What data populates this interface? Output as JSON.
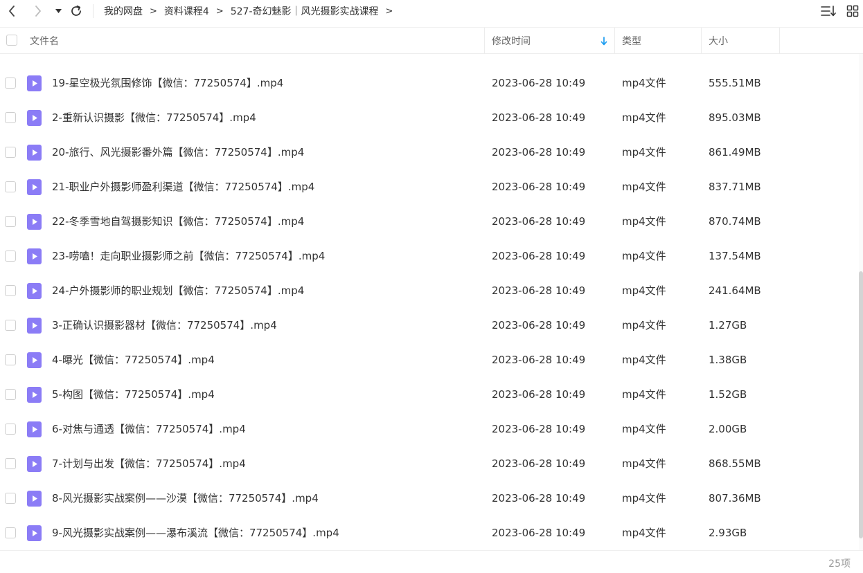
{
  "nav": {
    "breadcrumb": [
      {
        "label": "我的网盘"
      },
      {
        "label": "资料课程4"
      },
      {
        "label": "527-奇幻魅影｜风光摄影实战课程"
      }
    ],
    "separator": ">"
  },
  "columns": {
    "name": "文件名",
    "modified": "修改时间",
    "type": "类型",
    "size": "大小"
  },
  "sort": {
    "column": "modified",
    "direction": "descending",
    "arrow_color": "#1a9cf0"
  },
  "colors": {
    "file_icon": "#8b7cf6",
    "text": "#333333",
    "muted": "#999999"
  },
  "files": [
    {
      "name": "19-星空极光氛围修饰【微信：77250574】.mp4",
      "modified": "2023-06-28 10:49",
      "type": "mp4文件",
      "size": "555.51MB"
    },
    {
      "name": "2-重新认识摄影【微信：77250574】.mp4",
      "modified": "2023-06-28 10:49",
      "type": "mp4文件",
      "size": "895.03MB"
    },
    {
      "name": "20-旅行、风光摄影番外篇【微信：77250574】.mp4",
      "modified": "2023-06-28 10:49",
      "type": "mp4文件",
      "size": "861.49MB"
    },
    {
      "name": "21-职业户外摄影师盈利渠道【微信：77250574】.mp4",
      "modified": "2023-06-28 10:49",
      "type": "mp4文件",
      "size": "837.71MB"
    },
    {
      "name": "22-冬季雪地自驾摄影知识【微信：77250574】.mp4",
      "modified": "2023-06-28 10:49",
      "type": "mp4文件",
      "size": "870.74MB"
    },
    {
      "name": "23-唠嗑！走向职业摄影师之前【微信：77250574】.mp4",
      "modified": "2023-06-28 10:49",
      "type": "mp4文件",
      "size": "137.54MB"
    },
    {
      "name": "24-户外摄影师的职业规划【微信：77250574】.mp4",
      "modified": "2023-06-28 10:49",
      "type": "mp4文件",
      "size": "241.64MB"
    },
    {
      "name": "3-正确认识摄影器材【微信：77250574】.mp4",
      "modified": "2023-06-28 10:49",
      "type": "mp4文件",
      "size": "1.27GB"
    },
    {
      "name": "4-曝光【微信：77250574】.mp4",
      "modified": "2023-06-28 10:49",
      "type": "mp4文件",
      "size": "1.38GB"
    },
    {
      "name": "5-构图【微信：77250574】.mp4",
      "modified": "2023-06-28 10:49",
      "type": "mp4文件",
      "size": "1.52GB"
    },
    {
      "name": "6-对焦与通透【微信：77250574】.mp4",
      "modified": "2023-06-28 10:49",
      "type": "mp4文件",
      "size": "2.00GB"
    },
    {
      "name": "7-计划与出发【微信：77250574】.mp4",
      "modified": "2023-06-28 10:49",
      "type": "mp4文件",
      "size": "868.55MB"
    },
    {
      "name": "8-风光摄影实战案例——沙漠【微信：77250574】.mp4",
      "modified": "2023-06-28 10:49",
      "type": "mp4文件",
      "size": "807.36MB"
    },
    {
      "name": "9-风光摄影实战案例——瀑布溪流【微信：77250574】.mp4",
      "modified": "2023-06-28 10:49",
      "type": "mp4文件",
      "size": "2.93GB"
    }
  ],
  "footer": {
    "count": "25项"
  }
}
